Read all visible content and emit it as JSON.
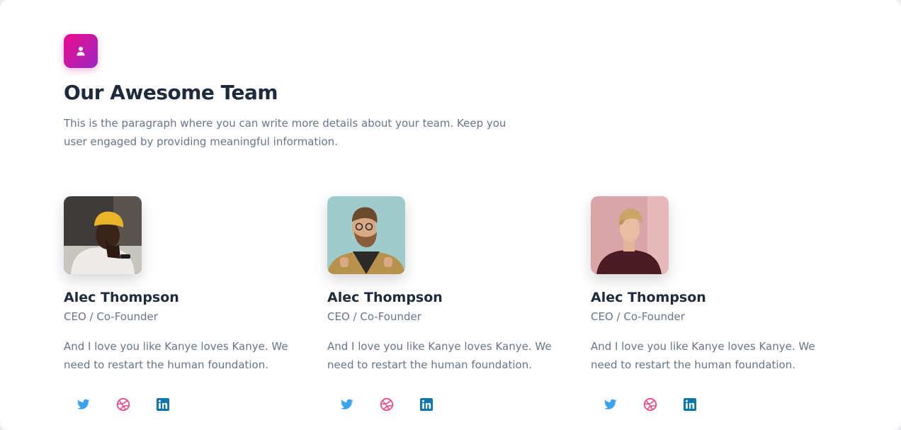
{
  "header": {
    "icon": "user-icon",
    "title": "Our Awesome Team",
    "lead": "This is the paragraph where you can write more details about your team. Keep you user engaged by providing meaningful information."
  },
  "colors": {
    "accent_gradient_start": "#ec0c8c",
    "accent_gradient_end": "#9b27c4",
    "twitter": "#3ea1ec",
    "dribbble": "#ea4c89",
    "linkedin": "#0e76a8"
  },
  "members": [
    {
      "name": "Alec Thompson",
      "role": "CEO / Co-Founder",
      "description": "And I love you like Kanye loves Kanye. We need to restart the human foundation.",
      "socials": [
        "twitter-icon",
        "dribbble-icon",
        "linkedin-icon"
      ]
    },
    {
      "name": "Alec Thompson",
      "role": "CEO / Co-Founder",
      "description": "And I love you like Kanye loves Kanye. We need to restart the human foundation.",
      "socials": [
        "twitter-icon",
        "dribbble-icon",
        "linkedin-icon"
      ]
    },
    {
      "name": "Alec Thompson",
      "role": "CEO / Co-Founder",
      "description": "And I love you like Kanye loves Kanye. We need to restart the human foundation.",
      "socials": [
        "twitter-icon",
        "dribbble-icon",
        "linkedin-icon"
      ]
    }
  ]
}
